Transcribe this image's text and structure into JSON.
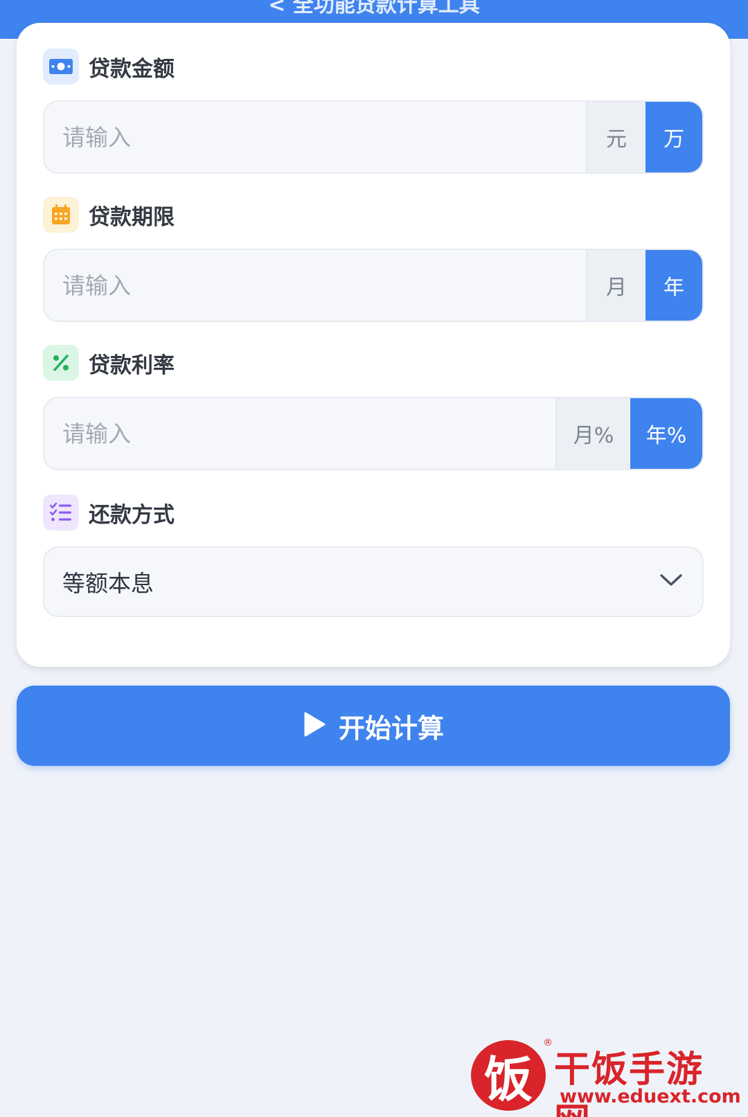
{
  "header": {
    "title": "< 全功能贷款计算工具"
  },
  "form": {
    "amount": {
      "label": "贷款金额",
      "icon": "money-icon",
      "placeholder": "请输入",
      "units": [
        "元",
        "万"
      ],
      "active_unit": "万"
    },
    "term": {
      "label": "贷款期限",
      "icon": "calendar-icon",
      "placeholder": "请输入",
      "units": [
        "月",
        "年"
      ],
      "active_unit": "年"
    },
    "rate": {
      "label": "贷款利率",
      "icon": "percent-icon",
      "placeholder": "请输入",
      "units": [
        "月%",
        "年%"
      ],
      "active_unit": "年%"
    },
    "repayment": {
      "label": "还款方式",
      "icon": "list-check-icon",
      "selected": "等额本息"
    }
  },
  "actions": {
    "calculate_label": "开始计算",
    "calculate_icon": "play-icon"
  },
  "watermark": {
    "glyph": "饭",
    "name": "干饭手游网",
    "url": "www.eduext.com",
    "registered": "®"
  },
  "colors": {
    "primary": "#3f83ee",
    "background": "#eff3f9",
    "amount_icon_bg": "#e1ecfd",
    "term_icon_bg": "#fdf1d6",
    "rate_icon_bg": "#dcf6e6",
    "repayment_icon_bg": "#efe6fd",
    "watermark_red": "#d8242a"
  }
}
